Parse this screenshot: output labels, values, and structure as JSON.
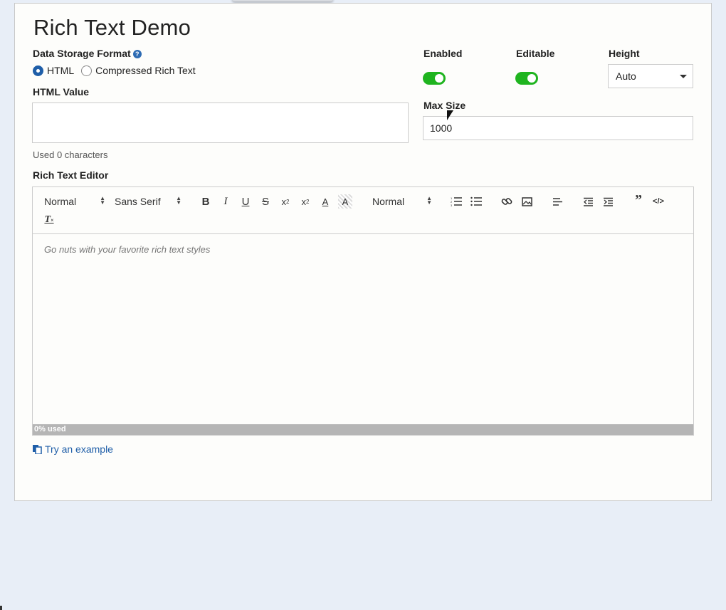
{
  "page": {
    "title": "Rich Text Demo"
  },
  "storage": {
    "label": "Data Storage Format",
    "options": [
      "HTML",
      "Compressed Rich Text"
    ],
    "selected": "HTML"
  },
  "html_value": {
    "label": "HTML Value",
    "value": "",
    "used_text": "Used 0 characters"
  },
  "enabled": {
    "label": "Enabled",
    "on": true
  },
  "editable": {
    "label": "Editable",
    "on": true
  },
  "height": {
    "label": "Height",
    "value": "Auto"
  },
  "max_size": {
    "label": "Max Size",
    "value": "1000"
  },
  "editor": {
    "label": "Rich Text Editor",
    "toolbar": {
      "header_select": "Normal",
      "font_select": "Sans Serif",
      "size_select": "Normal",
      "buttons": [
        "bold",
        "italic",
        "underline",
        "strike",
        "subscript",
        "superscript",
        "text-color",
        "background-color",
        "ordered-list",
        "bullet-list",
        "link",
        "image",
        "align-left",
        "outdent",
        "indent",
        "blockquote",
        "code-block",
        "clear-format"
      ]
    },
    "placeholder": "Go nuts with your favorite rich text styles",
    "usage_percent": 0,
    "usage_label": "0% used"
  },
  "example_link": "Try an example",
  "colors": {
    "accent": "#1f5ea8",
    "toggle_on": "#1fb41f",
    "background": "#e8eef7",
    "card": "#fdfdfb"
  }
}
